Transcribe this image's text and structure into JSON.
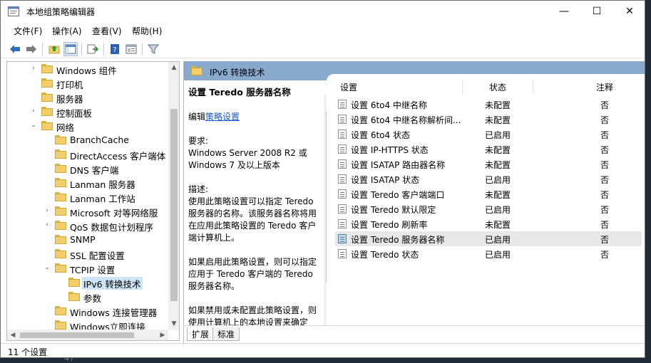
{
  "window": {
    "title": "本地组策略编辑器",
    "minimize": "—",
    "maximize": "☐",
    "close": "✕"
  },
  "menu": {
    "items": [
      {
        "label": "文件(F)"
      },
      {
        "label": "操作(A)"
      },
      {
        "label": "查看(V)"
      },
      {
        "label": "帮助(H)"
      }
    ]
  },
  "toolbar": {
    "icons": [
      "back-icon",
      "forward-icon",
      "up-folder-icon",
      "show-hide-tree-icon",
      "export-list-icon",
      "help-icon",
      "extended-view-icon",
      "filter-icon"
    ]
  },
  "tree": {
    "items": [
      {
        "label": "Windows 组件",
        "expander": "›"
      },
      {
        "label": "打印机",
        "expander": ""
      },
      {
        "label": "服务器",
        "expander": ""
      },
      {
        "label": "控制面板",
        "expander": "›"
      },
      {
        "label": "网络",
        "expander": "⌄"
      },
      {
        "label": "BranchCache",
        "expander": ""
      },
      {
        "label": "DirectAccess 客户端体",
        "expander": ""
      },
      {
        "label": "DNS 客户端",
        "expander": ""
      },
      {
        "label": "Lanman 服务器",
        "expander": ""
      },
      {
        "label": "Lanman 工作站",
        "expander": ""
      },
      {
        "label": "Microsoft 对等网络服",
        "expander": "›"
      },
      {
        "label": "QoS 数据包计划程序",
        "expander": "›"
      },
      {
        "label": "SNMP",
        "expander": ""
      },
      {
        "label": "SSL 配置设置",
        "expander": ""
      },
      {
        "label": "TCPIP 设置",
        "expander": "⌄"
      },
      {
        "label": "IPv6 转换技术",
        "expander": "",
        "selected": true
      },
      {
        "label": "参数",
        "expander": ""
      },
      {
        "label": "Windows 连接管理器",
        "expander": ""
      },
      {
        "label": "Windows立即连接",
        "expander": ""
      }
    ]
  },
  "header": {
    "title": "IPv6 转换技术"
  },
  "description": {
    "title": "设置 Teredo 服务器名称",
    "edit_prefix": "编辑",
    "edit_link": "策略设置",
    "requirements_label": "要求:",
    "requirements": "Windows Server 2008 R2 或 Windows 7 及以上版本",
    "desc_label": "描述:",
    "desc": "使用此策略设置可以指定 Teredo 服务器的名称。该服务器名称将用在应用此策略设置的 Teredo 客户端计算机上。",
    "enabled_text": "如果启用此策略设置，则可以指定应用于 Teredo 客户端的 Teredo 服务器名称。",
    "disabled_text": "如果禁用或未配置此策略设置，则使用计算机上的本地设置来确定"
  },
  "list": {
    "columns": {
      "setting": "设置",
      "state": "状态",
      "comment": "注释"
    },
    "rows": [
      {
        "name": "设置 6to4 中继名称",
        "state": "未配置",
        "comment": "否"
      },
      {
        "name": "设置 6to4 中继名称解析间...",
        "state": "未配置",
        "comment": "否"
      },
      {
        "name": "设置 6to4 状态",
        "state": "已启用",
        "comment": "否"
      },
      {
        "name": "设置 IP-HTTPS 状态",
        "state": "未配置",
        "comment": "否"
      },
      {
        "name": "设置 ISATAP 路由器名称",
        "state": "未配置",
        "comment": "否"
      },
      {
        "name": "设置 ISATAP 状态",
        "state": "已启用",
        "comment": "否"
      },
      {
        "name": "设置 Teredo 客户端端口",
        "state": "未配置",
        "comment": "否"
      },
      {
        "name": "设置 Teredo 默认限定",
        "state": "已启用",
        "comment": "否"
      },
      {
        "name": "设置 Teredo 刷新率",
        "state": "未配置",
        "comment": "否"
      },
      {
        "name": "设置 Teredo 服务器名称",
        "state": "已启用",
        "comment": "否",
        "selected": true
      },
      {
        "name": "设置 Teredo 状态",
        "state": "已启用",
        "comment": "否"
      }
    ]
  },
  "tabs": [
    {
      "label": "扩展"
    },
    {
      "label": "标准"
    }
  ],
  "status": {
    "text": "11 个设置"
  },
  "background": {
    "line_number": "47"
  }
}
